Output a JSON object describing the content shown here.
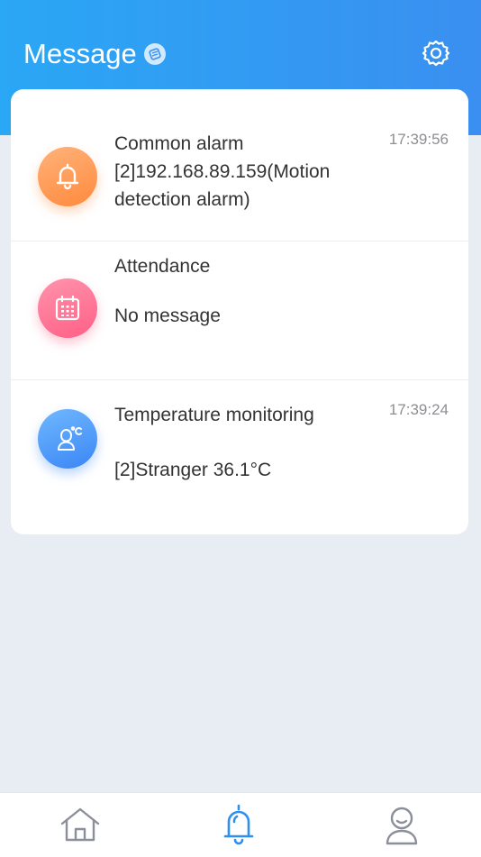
{
  "header": {
    "title": "Message",
    "title_badge_icon": "pen-badge-icon",
    "settings_icon": "gear-icon",
    "gradient": [
      "#2aa7f5",
      "#3a8ff0"
    ]
  },
  "messages": [
    {
      "category": "Common alarm",
      "icon": "bell-icon",
      "text": "[2]192.168.89.159(Motion detection alarm)",
      "time": "17:39:56",
      "color": "#ff8a3d"
    },
    {
      "category": "Attendance",
      "icon": "calendar-icon",
      "text": "No message",
      "time": "",
      "color": "#ff5f85"
    },
    {
      "category": "Temperature monitoring",
      "icon": "person-temperature-icon",
      "text": "[2]Stranger 36.1°C",
      "time": "17:39:24",
      "color": "#3b86f5"
    }
  ],
  "tabbar": {
    "items": [
      {
        "name": "home",
        "icon": "home-icon",
        "active": false
      },
      {
        "name": "message",
        "icon": "bell-icon",
        "active": true
      },
      {
        "name": "profile",
        "icon": "user-icon",
        "active": false
      }
    ],
    "active_color": "#2f8ff0",
    "inactive_color": "#8a8f99"
  }
}
